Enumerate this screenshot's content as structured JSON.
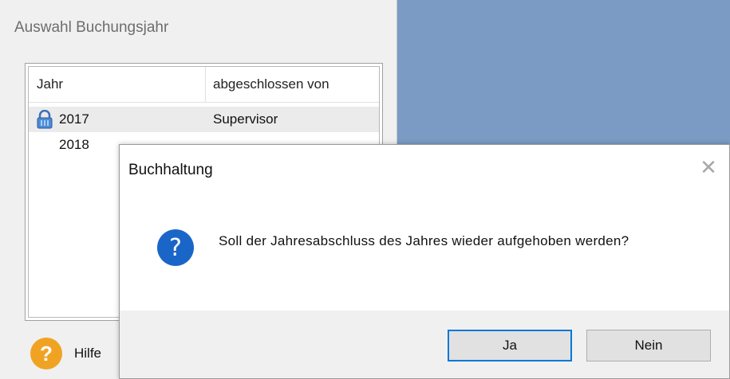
{
  "window": {
    "title": "Auswahl Buchungsjahr"
  },
  "table": {
    "columns": [
      "Jahr",
      "abgeschlossen von"
    ],
    "rows": [
      {
        "year": "2017",
        "closed_by": "Supervisor",
        "locked": true
      },
      {
        "year": "2018",
        "closed_by": "",
        "locked": false
      }
    ]
  },
  "help": {
    "label": "Hilfe",
    "icon": "question-mark-icon",
    "icon_char": "?"
  },
  "dialog": {
    "title": "Buchhaltung",
    "close_icon": "close-icon",
    "close_char": "✕",
    "icon": "question-icon",
    "icon_char": "?",
    "message": "Soll der Jahresabschluss des Jahres  wieder aufgehoben werden?",
    "yes_label": "Ja",
    "no_label": "Nein"
  },
  "colors": {
    "desktop": "#7b9bc4",
    "question_icon": "#1a66c8",
    "help_icon": "#f0a323",
    "default_button_border": "#0078d7"
  }
}
